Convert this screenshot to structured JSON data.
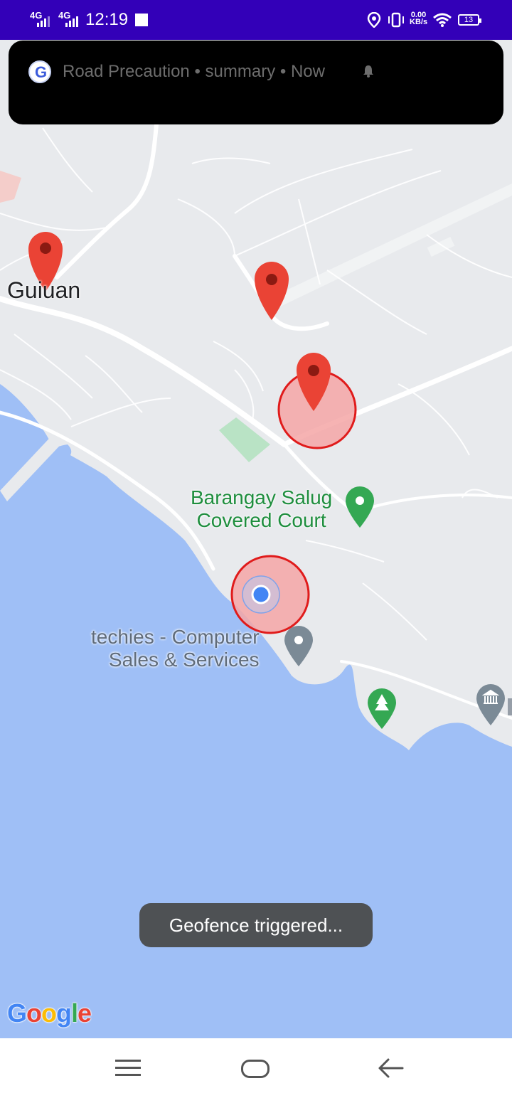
{
  "status_bar": {
    "network_1": "4G",
    "network_2": "4G",
    "time": "12:19",
    "speed_value": "0.00",
    "speed_unit": "KB/s",
    "battery_level": "13"
  },
  "notification": {
    "app_name": "Road Precaution",
    "title": "summary",
    "time": "Now",
    "separator": "•"
  },
  "map": {
    "places": {
      "town": "Guiuan",
      "poi_court_line1": "Barangay Salug",
      "poi_court_line2": "Covered Court",
      "poi_shop_line1": "techies - Computer",
      "poi_shop_line2": "Sales & Services"
    },
    "colors": {
      "water": "#9fbff6",
      "land": "#e8eaed",
      "road": "#ffffff",
      "marker_red": "#ea4335",
      "geofence_fill": "#f4a6a6",
      "geofence_stroke": "#e01b1b",
      "user_dot": "#4285f4"
    },
    "attribution": "Google"
  },
  "toast": {
    "message": "Geofence triggered..."
  },
  "nav_bar": {
    "icons": [
      "menu-icon",
      "home-icon",
      "back-icon"
    ]
  }
}
